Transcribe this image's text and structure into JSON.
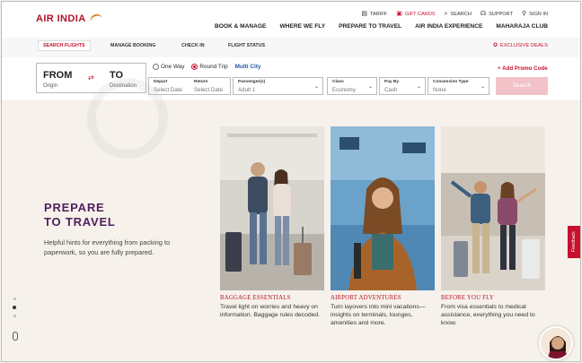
{
  "brand": {
    "logo_text": "AIR INDIA"
  },
  "util_nav": [
    {
      "label": "TARIFF",
      "icon": "tariff-icon",
      "glyph": "▤"
    },
    {
      "label": "GIFT CARDS",
      "icon": "gift-icon",
      "glyph": "🎁",
      "color": "#c8102e"
    },
    {
      "label": "SEARCH",
      "icon": "search-icon",
      "glyph": "⌕"
    },
    {
      "label": "SUPPORT",
      "icon": "headset-icon",
      "glyph": "☊"
    },
    {
      "label": "SIGN IN",
      "icon": "user-icon",
      "glyph": "⚲"
    }
  ],
  "main_nav": [
    "BOOK & MANAGE",
    "WHERE WE FLY",
    "PREPARE TO TRAVEL",
    "AIR INDIA EXPERIENCE",
    "MAHARAJA CLUB"
  ],
  "tabs": [
    "SEARCH FLIGHTS",
    "MANAGE BOOKING",
    "CHECK IN",
    "FLIGHT STATUS"
  ],
  "exclusive_deals": "EXCLUSIVE DEALS",
  "booking": {
    "from": {
      "code": "FROM",
      "sub": "Origin"
    },
    "to": {
      "code": "TO",
      "sub": "Destination"
    },
    "trip_types": [
      {
        "label": "One Way",
        "selected": false
      },
      {
        "label": "Round Trip",
        "selected": true
      }
    ],
    "multi_city": "Multi City",
    "fields": [
      {
        "label": "Depart",
        "value": "Select Date"
      },
      {
        "label": "Return",
        "value": "Select Date"
      },
      {
        "label": "Passenger(s)",
        "value": "Adult 1"
      },
      {
        "label": "Class",
        "value": "Economy"
      },
      {
        "label": "Pay By",
        "value": "Cash"
      },
      {
        "label": "Concession Type",
        "value": "None"
      }
    ],
    "promo": "+ Add Promo Code",
    "search_label": "Search"
  },
  "hero": {
    "title_line1": "PREPARE",
    "title_line2": "TO TRAVEL",
    "desc": "Helpful hints for everything from packing to paperwork, so you are fully prepared."
  },
  "cards": [
    {
      "title": "BAGGAGE ESSENTIALS",
      "desc": "Travel light on worries and heavy on information. Baggage rules decoded."
    },
    {
      "title": "AIRPORT ADVENTURES",
      "desc": "Turn layovers into mini vacations—insights on terminals, lounges, amenities and more."
    },
    {
      "title": "BEFORE YOU FLY",
      "desc": "From visa essentials to medical assistance, everything you need to know."
    }
  ],
  "feedback": "Feedback",
  "colors": {
    "brand": "#c8102e",
    "heading": "#4d1f5e"
  }
}
